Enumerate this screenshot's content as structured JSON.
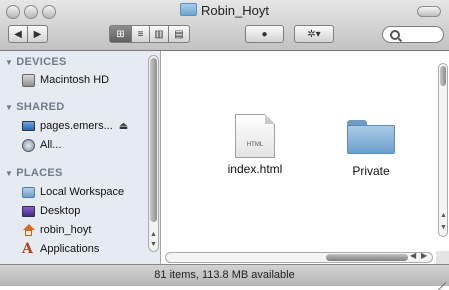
{
  "window": {
    "title": "Robin_Hoyt"
  },
  "toolbar": {
    "nav_back": "◀",
    "nav_forward": "▶",
    "view_icon": "⊞",
    "view_list": "≡",
    "view_columns": "▥",
    "view_coverflow": "▤",
    "quicklook": "●",
    "action": "✲▾"
  },
  "sidebar": {
    "sections": [
      {
        "label": "DEVICES",
        "items": [
          {
            "label": "Macintosh HD",
            "icon": "hard-drive-icon"
          }
        ]
      },
      {
        "label": "SHARED",
        "items": [
          {
            "label": "pages.emers...",
            "icon": "network-monitor-icon",
            "eject": "⏏"
          },
          {
            "label": "All...",
            "icon": "network-globe-icon"
          }
        ]
      },
      {
        "label": "PLACES",
        "items": [
          {
            "label": "Local Workspace",
            "icon": "folder-icon"
          },
          {
            "label": "Desktop",
            "icon": "desktop-icon"
          },
          {
            "label": "robin_hoyt",
            "icon": "home-icon"
          },
          {
            "label": "Applications",
            "icon": "applications-icon"
          }
        ]
      }
    ]
  },
  "files": [
    {
      "name": "index.html",
      "type": "html-file",
      "tag": "HTML"
    },
    {
      "name": "Private",
      "type": "folder"
    }
  ],
  "status": {
    "text": "81 items, 113.8 MB available"
  }
}
